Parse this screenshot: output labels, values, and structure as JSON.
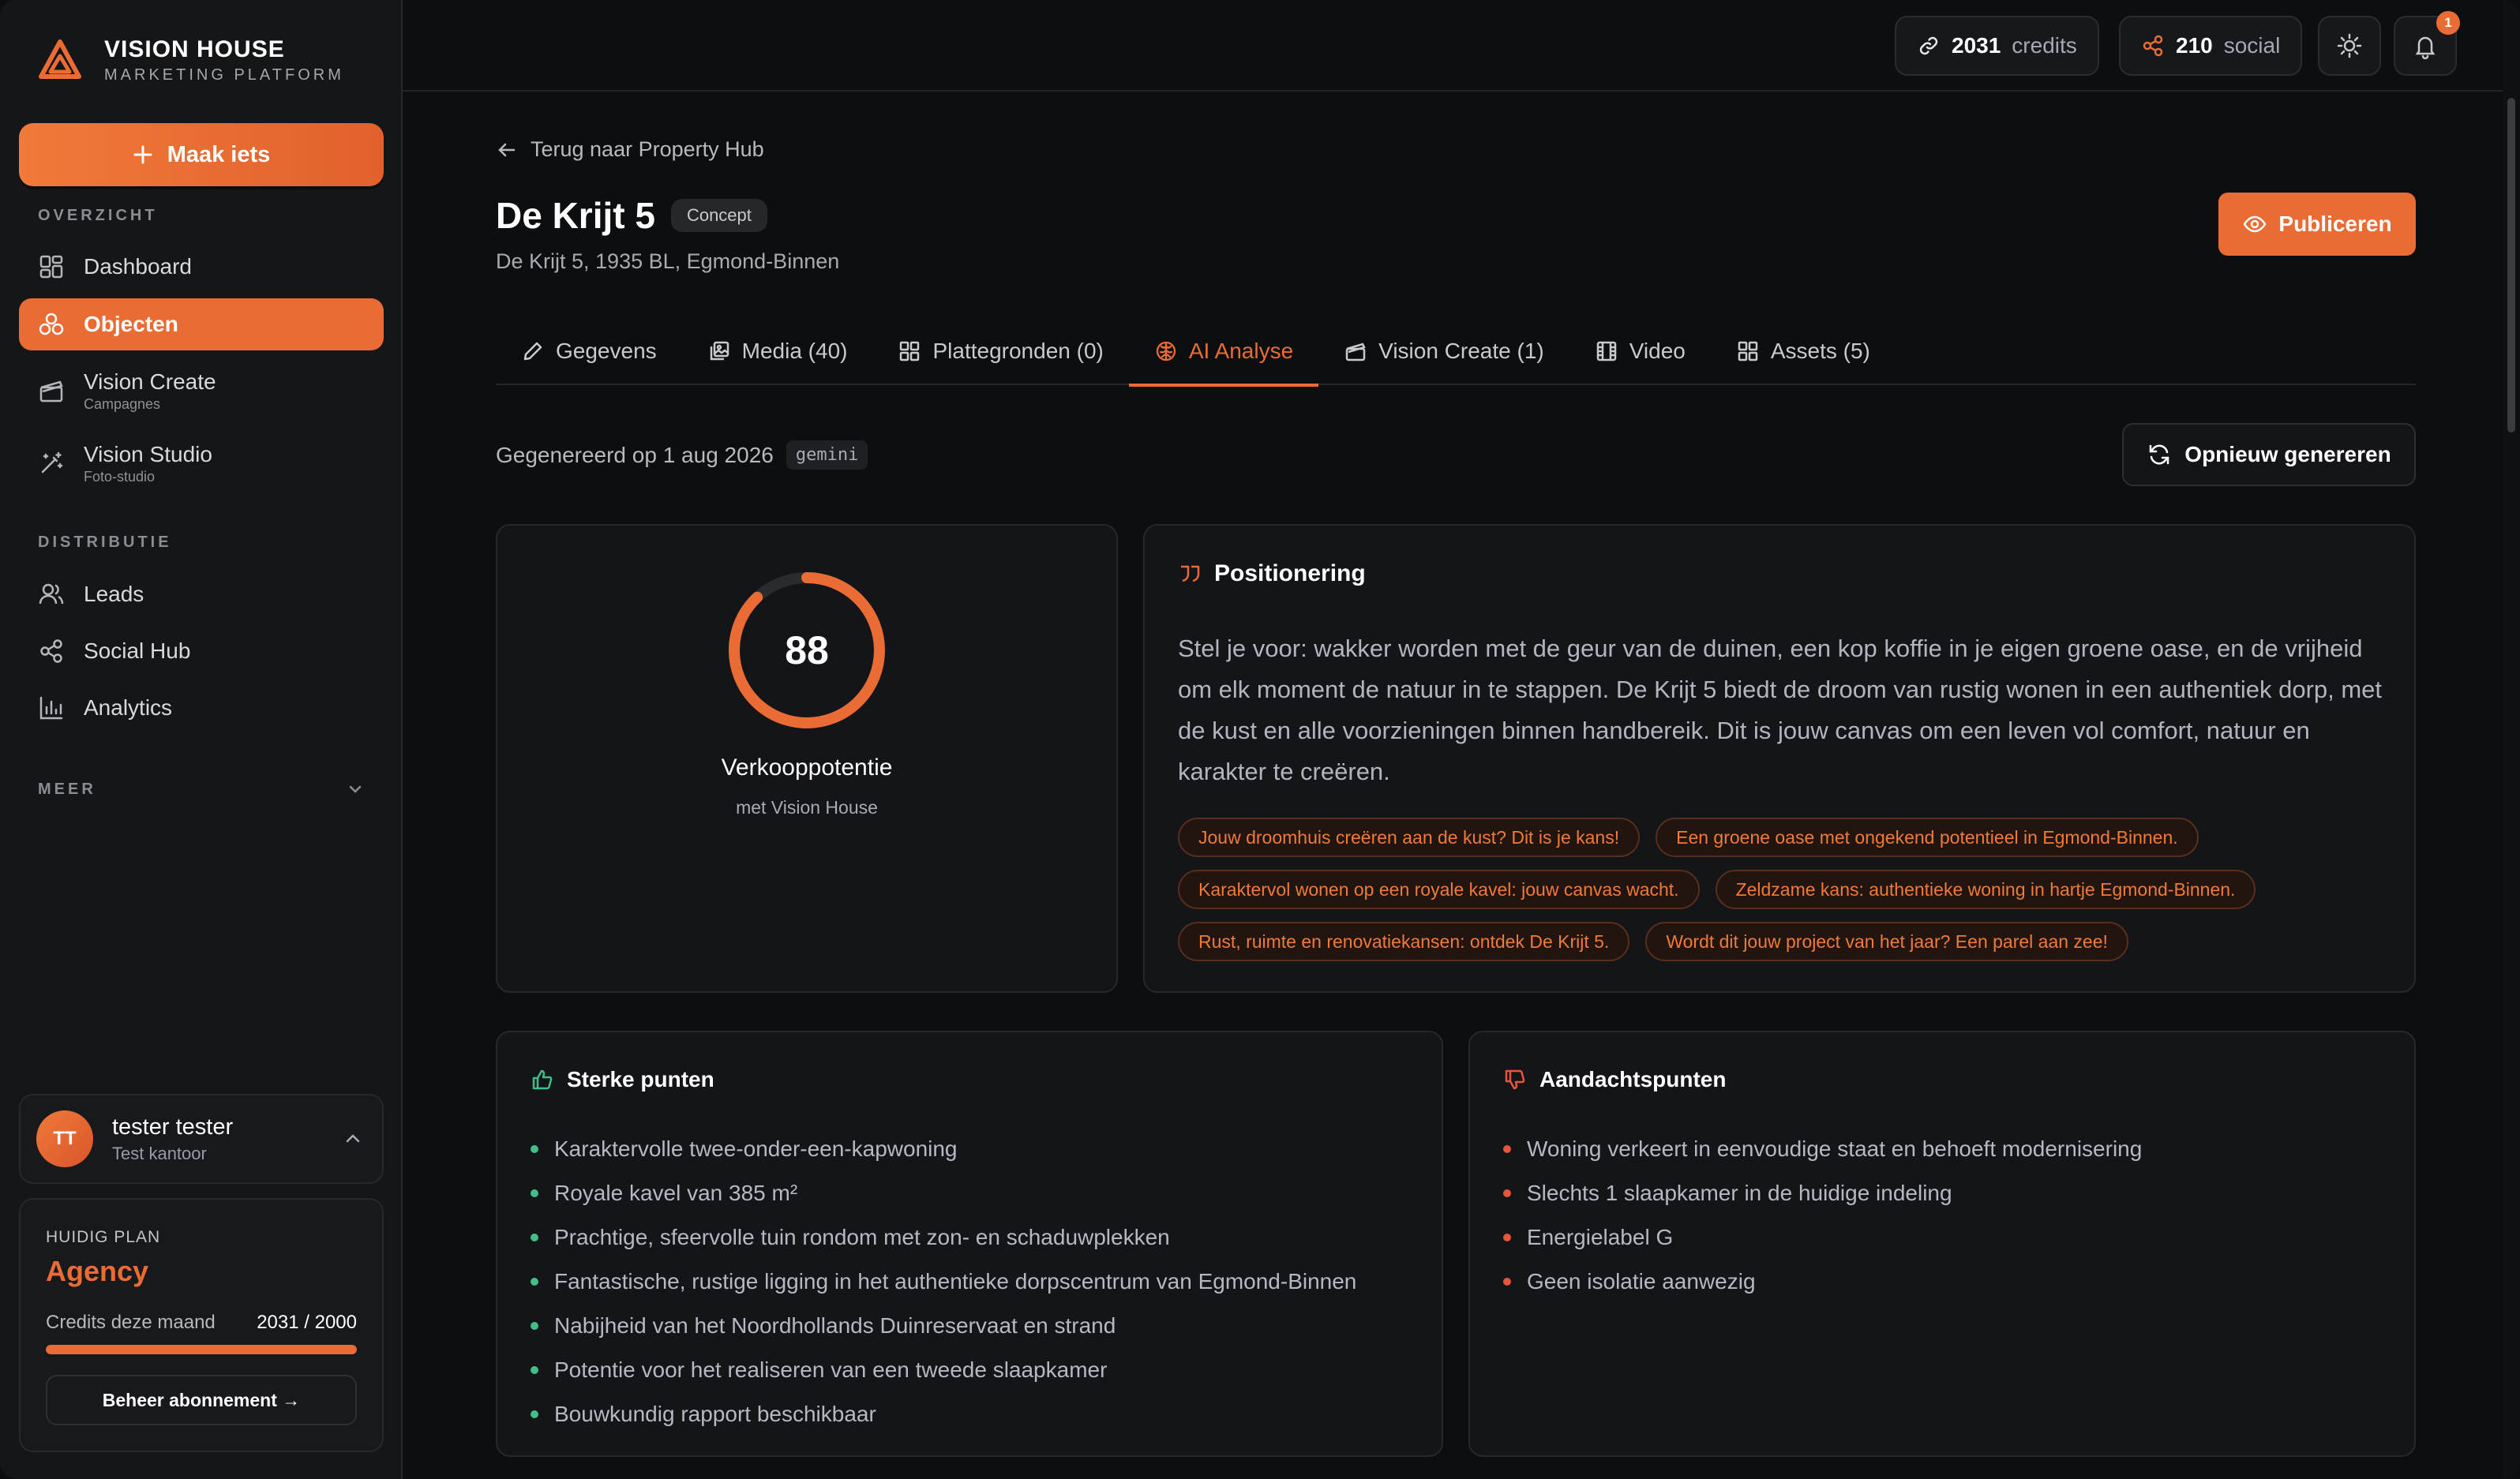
{
  "brand": {
    "title": "VISION HOUSE",
    "subtitle": "MARKETING PLATFORM"
  },
  "sidebar": {
    "create_label": "Maak iets",
    "sections": {
      "overview": "OVERZICHT",
      "distribution": "DISTRIBUTIE",
      "more": "MEER"
    },
    "items": [
      {
        "label": "Dashboard",
        "icon": "dashboard-icon"
      },
      {
        "label": "Objecten",
        "icon": "objects-icon",
        "active": true
      },
      {
        "label": "Vision Create",
        "sub": "Campagnes",
        "icon": "clapperboard-icon"
      },
      {
        "label": "Vision Studio",
        "sub": "Foto-studio",
        "icon": "magic-wand-icon"
      },
      {
        "label": "Leads",
        "icon": "users-icon"
      },
      {
        "label": "Social Hub",
        "icon": "share-icon"
      },
      {
        "label": "Analytics",
        "icon": "bar-chart-icon"
      }
    ],
    "user": {
      "initials": "TT",
      "name": "tester tester",
      "office": "Test kantoor"
    },
    "plan": {
      "label": "HUIDIG PLAN",
      "name": "Agency",
      "credits_label": "Credits deze maand",
      "credits_value": "2031 / 2000",
      "credits_fraction": 1.0,
      "manage_label": "Beheer abonnement →"
    }
  },
  "topbar": {
    "credits_num": "2031",
    "credits_unit": "credits",
    "social_num": "210",
    "social_unit": "social",
    "notification_count": "1"
  },
  "page": {
    "back_label": "Terug naar Property Hub",
    "title": "De Krijt 5",
    "status": "Concept",
    "address": "De Krijt 5, 1935 BL, Egmond-Binnen",
    "publish_label": "Publiceren"
  },
  "tabs": [
    {
      "label": "Gegevens",
      "icon": "pencil-icon"
    },
    {
      "label": "Media (40)",
      "icon": "images-icon"
    },
    {
      "label": "Plattegronden (0)",
      "icon": "grid-icon"
    },
    {
      "label": "AI Analyse",
      "icon": "brain-icon",
      "active": true
    },
    {
      "label": "Vision Create (1)",
      "icon": "clapperboard-icon"
    },
    {
      "label": "Video",
      "icon": "film-icon"
    },
    {
      "label": "Assets (5)",
      "icon": "grid-icon"
    }
  ],
  "analysis": {
    "generated_text": "Gegenereerd op 1 aug 2026",
    "model": "gemini",
    "regenerate_label": "Opnieuw genereren",
    "score": 88,
    "score_max": 100,
    "score_label": "Verkooppotentie",
    "score_sub": "met Vision House",
    "positioning_title": "Positionering",
    "positioning_text": "Stel je voor: wakker worden met de geur van de duinen, een kop koffie in je eigen groene oase, en de vrijheid om elk moment de natuur in te stappen. De Krijt 5 biedt de droom van rustig wonen in een authentiek dorp, met de kust en alle voorzieningen binnen handbereik. Dit is jouw canvas om een leven vol comfort, natuur en karakter te creëren.",
    "tags": [
      "Jouw droomhuis creëren aan de kust? Dit is je kans!",
      "Een groene oase met ongekend potentieel in Egmond-Binnen.",
      "Karaktervol wonen op een royale kavel: jouw canvas wacht.",
      "Zeldzame kans: authentieke woning in hartje Egmond-Binnen.",
      "Rust, ruimte en renovatiekansen: ontdek De Krijt 5.",
      "Wordt dit jouw project van het jaar? Een parel aan zee!"
    ],
    "strengths_title": "Sterke punten",
    "strengths": [
      "Karaktervolle twee-onder-een-kapwoning",
      "Royale kavel van 385 m²",
      "Prachtige, sfeervolle tuin rondom met zon- en schaduwplekken",
      "Fantastische, rustige ligging in het authentieke dorpscentrum van Egmond-Binnen",
      "Nabijheid van het Noordhollands Duinreservaat en strand",
      "Potentie voor het realiseren van een tweede slaapkamer",
      "Bouwkundig rapport beschikbaar"
    ],
    "concerns_title": "Aandachtspunten",
    "concerns": [
      "Woning verkeert in eenvoudige staat en behoeft modernisering",
      "Slechts 1 slaapkamer in de huidige indeling",
      "Energielabel G",
      "Geen isolatie aanwezig"
    ]
  },
  "colors": {
    "accent": "#ea6c34",
    "positive": "#3fbf86",
    "negative": "#e8553a",
    "background": "#0d0e10"
  }
}
